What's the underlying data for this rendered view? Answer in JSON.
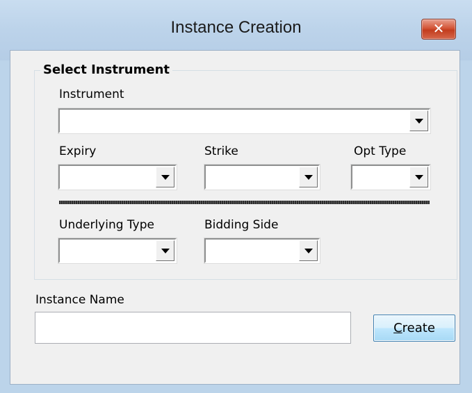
{
  "window": {
    "title": "Instance Creation",
    "close_glyph": "✕"
  },
  "group": {
    "title": "Select Instrument",
    "instrument_label": "Instrument",
    "instrument_value": "",
    "expiry_label": "Expiry",
    "expiry_value": "",
    "strike_label": "Strike",
    "strike_value": "",
    "opt_type_label": "Opt Type",
    "opt_type_value": "",
    "underlying_type_label": "Underlying Type",
    "underlying_type_value": "",
    "bidding_side_label": "Bidding Side",
    "bidding_side_value": ""
  },
  "instance": {
    "name_label": "Instance Name",
    "name_value": ""
  },
  "actions": {
    "create_mnemonic": "C",
    "create_rest": "reate"
  },
  "icons": {
    "close": "close-icon",
    "dropdown": "chevron-down-icon"
  },
  "colors": {
    "titlebar": "#bcd4ea",
    "client": "#f0f0f0",
    "close_button": "#c9452a",
    "create_button_border": "#3c7fb1"
  }
}
